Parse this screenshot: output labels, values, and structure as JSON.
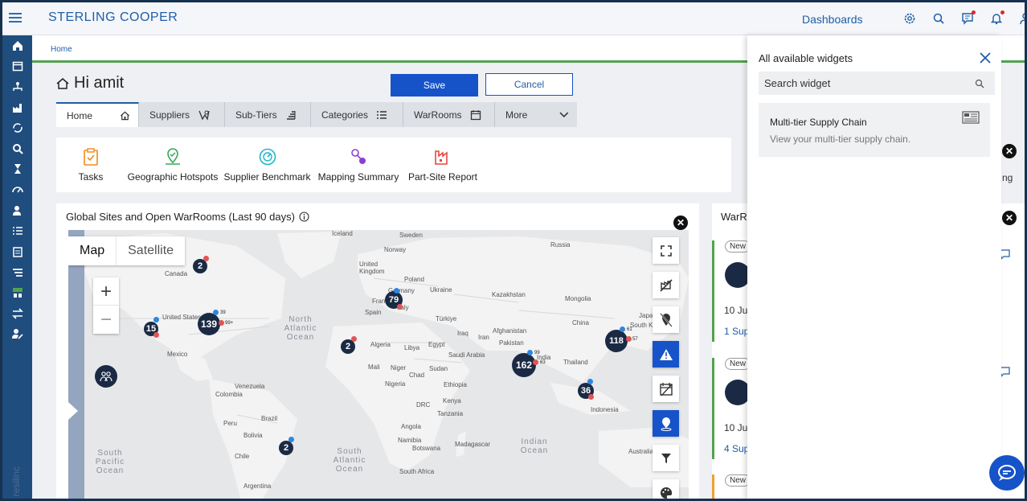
{
  "app": {
    "brand": "STERLING COOPER",
    "dashboards_link": "Dashboards"
  },
  "breadcrumb": {
    "home": "Home"
  },
  "greeting": "Hi amit",
  "actions": {
    "save": "Save",
    "cancel": "Cancel"
  },
  "tabs": [
    {
      "label": "Home",
      "icon": "home-icon"
    },
    {
      "label": "Suppliers",
      "icon": "supplier-icon"
    },
    {
      "label": "Sub-Tiers",
      "icon": "sub-tiers-icon"
    },
    {
      "label": "Categories",
      "icon": "list-icon"
    },
    {
      "label": "WarRooms",
      "icon": "calendar-icon"
    },
    {
      "label": "More",
      "icon": "chevron-down-icon"
    }
  ],
  "quick_links": [
    {
      "label": "Tasks",
      "icon": "clipboard-icon",
      "color": "#f08c1a"
    },
    {
      "label": "Geographic Hotspots",
      "icon": "map-pin-icon",
      "color": "#39a857"
    },
    {
      "label": "Supplier Benchmark",
      "icon": "gauge-icon",
      "color": "#1cb5c9"
    },
    {
      "label": "Mapping Summary",
      "icon": "nodes-icon",
      "color": "#8a3fd1"
    },
    {
      "label": "Part-Site Report",
      "icon": "factory-icon",
      "color": "#e5473f"
    }
  ],
  "map_card": {
    "title": "Global Sites and Open WarRooms (Last 90 days)",
    "map_toggle": {
      "map": "Map",
      "satellite": "Satellite"
    },
    "zoom": {
      "in": "+",
      "out": "−"
    },
    "clusters": [
      {
        "count": "2",
        "label": "Canada"
      },
      {
        "count": "15",
        "label": ""
      },
      {
        "count": "139",
        "label": ""
      },
      {
        "count": "79",
        "label": ""
      },
      {
        "count": "2",
        "label": ""
      },
      {
        "count": "162",
        "label": ""
      },
      {
        "count": "118",
        "label": ""
      },
      {
        "count": "36",
        "label": ""
      },
      {
        "count": "2",
        "label": ""
      }
    ],
    "mini_counts": [
      "39",
      "99+",
      "99",
      "63",
      "61",
      "57"
    ],
    "places": [
      "Iceland",
      "Sweden",
      "Norway",
      "Russia",
      "United Kingdom",
      "Poland",
      "Ukraine",
      "Kazakhstan",
      "Mongolia",
      "Germany",
      "France",
      "Spain",
      "Italy",
      "Türkiye",
      "Iraq",
      "Iran",
      "Afghanistan",
      "Pakistan",
      "China",
      "South Korea",
      "Japan",
      "Algeria",
      "Libya",
      "Egypt",
      "Saudi Arabia",
      "India",
      "Thailand",
      "Mali",
      "Niger",
      "Chad",
      "Sudan",
      "Ethiopia",
      "Nigeria",
      "Kenya",
      "DRC",
      "Tanzania",
      "Angola",
      "Namibia",
      "Botswana",
      "Madagascar",
      "South Africa",
      "Indonesia",
      "Australia",
      "Canada",
      "United States",
      "Mexico",
      "Venezuela",
      "Colombia",
      "Peru",
      "Brazil",
      "Bolivia",
      "Chile",
      "Argentina"
    ],
    "oceans": [
      "North Atlantic Ocean",
      "South Pacific Ocean",
      "South Atlantic Ocean",
      "Indian Ocean"
    ]
  },
  "warrooms_card": {
    "title": "WarR",
    "items": [
      {
        "badge": "New",
        "date": "10 Ju",
        "link": "1 Sup",
        "bar_color": "#52a24f"
      },
      {
        "badge": "New",
        "date": "10 Ju",
        "link": "4 Sup",
        "bar_color": "#52a24f"
      },
      {
        "badge": "New",
        "date": "",
        "link": "",
        "bar_color": "#f0a030"
      }
    ]
  },
  "right_peek": {
    "text": "ng"
  },
  "widgets_panel": {
    "title": "All available widgets",
    "search_placeholder": "Search widget",
    "widgets": [
      {
        "name": "Multi-tier Supply Chain",
        "description": "View your multi-tier supply chain."
      }
    ]
  },
  "rail_logo": "resilinc"
}
